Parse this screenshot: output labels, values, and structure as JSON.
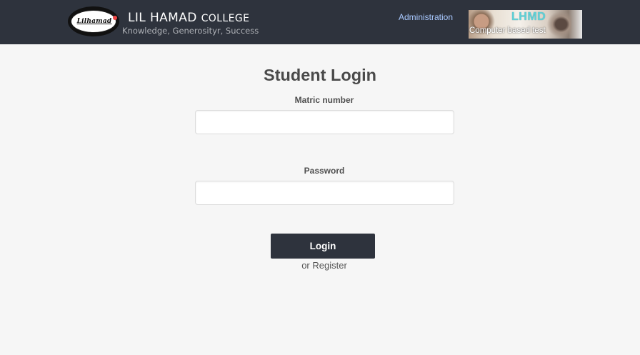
{
  "header": {
    "logo_text": "Lilhamad",
    "title_main": "LIL HAMAD",
    "title_college": "COLLEGE",
    "tagline": "Knowledge, Generosityr, Success",
    "admin_link": "Administration",
    "banner": {
      "logo": "LHMD",
      "caption": "Computer based test"
    },
    "colors": {
      "bar": "#2e333d",
      "link": "#a9c9ff",
      "banner_logo": "#5fd0d6"
    }
  },
  "login": {
    "title": "Student Login",
    "matric_label": "Matric number",
    "matric_value": "",
    "password_label": "Password",
    "password_value": "",
    "button": "Login",
    "register_prefix": "or",
    "register_link": "Register"
  }
}
